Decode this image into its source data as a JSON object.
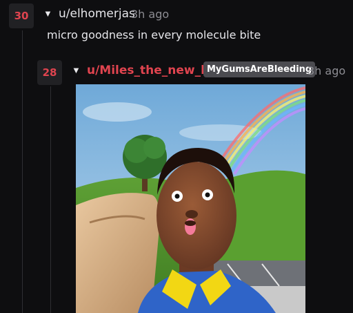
{
  "comments": [
    {
      "score": "30",
      "username": "u/elhomerjas",
      "time": "3h ago",
      "body": "micro goodness in every molecule bite"
    },
    {
      "score": "28",
      "username": "u/Miles_the_new_kid",
      "flair": "MyGumsAreBleeding",
      "time": "3h ago"
    }
  ],
  "icons": {
    "collapse": "caret-down-icon"
  },
  "colors": {
    "background": "#0e0e10",
    "score": "#e0444f",
    "op_username": "#e0444f",
    "flair_bg": "#4b4b50"
  }
}
